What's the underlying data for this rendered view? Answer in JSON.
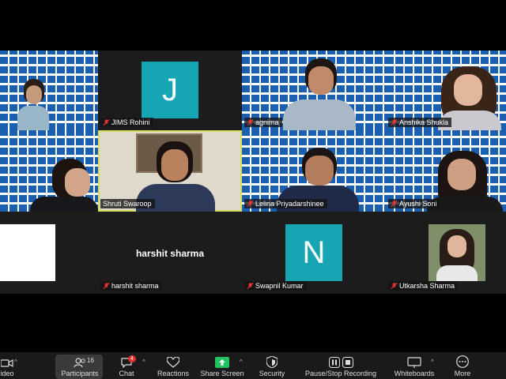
{
  "participants": [
    {
      "name": "",
      "avatar_letter": "",
      "speaking": false
    },
    {
      "name": "JIMS Rohini",
      "avatar_letter": "J",
      "speaking": false
    },
    {
      "name": "agnima",
      "avatar_letter": "",
      "speaking": false
    },
    {
      "name": "Anshika Shukla",
      "avatar_letter": "",
      "speaking": false
    },
    {
      "name": "",
      "avatar_letter": "",
      "speaking": false
    },
    {
      "name": "Shruti Swaroop",
      "avatar_letter": "",
      "speaking": true
    },
    {
      "name": "Lelina Priyadarshinee",
      "avatar_letter": "",
      "speaking": false
    },
    {
      "name": "Ayushi Soni",
      "avatar_letter": "",
      "speaking": false
    },
    {
      "name": "",
      "avatar_letter": "",
      "speaking": false
    },
    {
      "name": "harshit sharma",
      "display_name": "harshit sharma",
      "speaking": false
    },
    {
      "name": "Swapnil Kumar",
      "avatar_letter": "N",
      "speaking": false
    },
    {
      "name": "Utkarsha Sharma",
      "avatar_letter": "",
      "speaking": false
    }
  ],
  "toolbar": {
    "video_label": "ideo",
    "participants_label": "Participants",
    "participants_count": "16",
    "chat_label": "Chat",
    "chat_badge": "4",
    "reactions_label": "Reactions",
    "share_label": "Share Screen",
    "security_label": "Security",
    "recording_label": "Pause/Stop Recording",
    "whiteboards_label": "Whiteboards",
    "more_label": "More"
  },
  "colors": {
    "avatar_bg": "#16a6b3",
    "share_green": "#22c35e",
    "speaking_border": "#d8e05a",
    "backdrop_blue": "#1b5fb0"
  }
}
